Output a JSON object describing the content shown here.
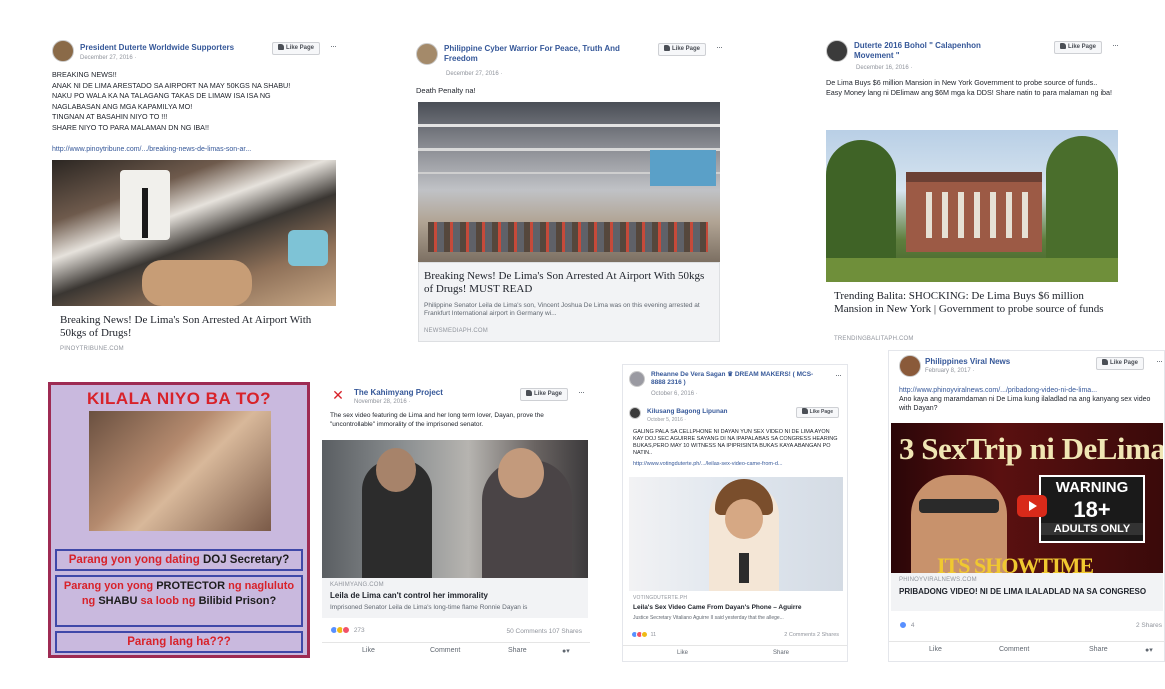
{
  "post1": {
    "page_name": "President Duterte Worldwide Supporters",
    "date": "December 27, 2016 · ",
    "like_label": "Like Page",
    "more": "···",
    "text": "BREAKING NEWS!!\nANAK NI DE LIMA ARESTADO SA AIRPORT NA MAY 50KGS NA SHABU!\nNAKU PO WALA KA NA TALAGANG TAKAS DE LIMAW ISA ISA NG\nNAGLABASAN ANG MGA KAPAMILYA MO!\nTINGNAN AT BASAHIN NIYO TO !!!\nSHARE NIYO TO PARA MALAMAN DN NG IBA!!",
    "link": "http://www.pinoytribune.com/.../breaking-news-de-limas-son-ar...",
    "link_title": "Breaking News! De Lima's Son Arrested At Airport With 50kgs of Drugs!",
    "link_domain": "PINOYTRIBUNE.COM"
  },
  "post2": {
    "page_name": "Philippine Cyber Warrior For Peace, Truth And Freedom",
    "date": "December 27, 2016 · ",
    "like_label": "Like Page",
    "more": "···",
    "text": "Death Penalty na!",
    "link_title": "Breaking News! De Lima's Son Arrested At Airport With 50kgs of Drugs! MUST READ",
    "link_desc": "Philippine Senator Leila de Lima's son, Vincent Joshua De Lima was on this evening arrested at Frankfurt International airport in Germany wi...",
    "link_domain": "NEWSMEDIAPH.COM"
  },
  "post3": {
    "page_name": "Duterte 2016 Bohol \" Calapenhon Movement \"",
    "date": "December 16, 2016 · ",
    "like_label": "Like Page",
    "more": "···",
    "text": "De Lima Buys $6 million Mansion in New York Government to probe source of funds..\nEasy Money lang ni DElimaw ang $6M mga ka DDS! Share natin to para malaman ng iba!",
    "link_title": "Trending Balita: SHOCKING: De Lima Buys $6 million Mansion in New York | Government to probe source of funds",
    "link_domain": "TRENDINGBALITAPH.COM"
  },
  "meme": {
    "headline": "KILALA NIYO BA TO?",
    "line1_a": "Parang yon yong dating ",
    "line1_b": "DOJ Secretary?",
    "line2_a": "Parang yon yong ",
    "line2_b": "PROTECTOR",
    "line2_c": " ng nagluluto ng ",
    "line2_d": "SHABU",
    "line2_e": " sa loob ng ",
    "line2_f": "Bilibid Prison?",
    "line3": "Parang lang ha???"
  },
  "post5": {
    "page_name": "The Kahimyang Project",
    "date": "November 28, 2016 · ",
    "like_label": "Like Page",
    "more": "···",
    "text": "The sex video featuring de Lima and her long term lover, Dayan, prove the \"uncontrollable\" immorality of the imprisoned senator.",
    "link_domain": "KAHIMYANG.COM",
    "link_title": "Leila de Lima can't control her immorality",
    "link_desc": "Imprisoned Senator Leila de Lima's long-time flame Ronnie Dayan is",
    "reactions": "273",
    "comments_shares": "50 Comments  107 Shares",
    "like": "Like",
    "comment": "Comment",
    "share": "Share"
  },
  "post6": {
    "page_name": "Rheanne De Vera Sagan ♛ DREAM MAKERS! ( MCS-8888 2316 )",
    "date": "October 6, 2016 · ",
    "more": "···",
    "shared_page": "Kilusang Bagong Lipunan",
    "shared_date": "October 5, 2016 · ",
    "like_label": "Like Page",
    "text": "GALING PALA SA CELLPHONE NI DAYAN YUN SEX VIDEO NI DE LIMA AYON KAY DOJ SEC AGUIRRE SAYANG DI NA IPAPALABAS SA CONGRESS HEARING BUKAS,PERO MAY 10 WITNESS NA IPIPRISINTA BUKAS KAYA ABANGAN PO NATIN..",
    "link": "http://www.votingduterte.ph/.../leilas-sex-video-came-from-d...",
    "link_domain": "VOTINGDUTERTE.PH",
    "link_title": "Leila's Sex Video Came From Dayan's Phone – Aguirre",
    "link_desc": "Justice Secretary Vitaliano Aguirre II said yesterday that the allege...",
    "reactions": "11",
    "comments_shares": "2 Comments  2 Shares",
    "like": "Like",
    "share": "Share"
  },
  "post7": {
    "page_name": "Philippines Viral News",
    "date": "February 8, 2017 · ",
    "like_label": "Like Page",
    "more": "···",
    "link": "http://www.phinoyviralnews.com/.../pribadong-video-ni-de-lima...",
    "text": "Ano kaya ang maramdaman ni De Lima kung ilaladlad na ang kanyang sex video with Dayan?",
    "banner": "3 SexTrip ni DeLima",
    "warning": "WARNING",
    "age": "18+",
    "adults": "ADULTS ONLY",
    "showtime": "ITS SHOWTIME",
    "link_domain": "PHINOYVIRALNEWS.COM",
    "link_title": "PRIBADONG VIDEO! NI DE LIMA ILALADLAD NA SA CONGRESO",
    "reactions": "4",
    "shares": "2 Shares",
    "like": "Like",
    "comment": "Comment",
    "share": "Share"
  },
  "colors": {
    "fb_blue": "#365899",
    "meme_bg": "#c9b9de",
    "meme_red": "#d8222a",
    "meme_border": "#9e2b53",
    "meme_box": "#3f48a8"
  }
}
